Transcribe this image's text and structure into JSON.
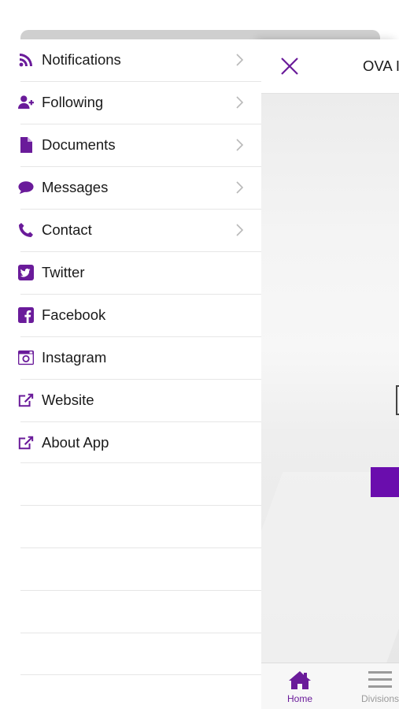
{
  "menu": {
    "items": [
      {
        "label": "Notifications",
        "icon": "rss-icon",
        "has_chevron": true
      },
      {
        "label": "Following",
        "icon": "user-plus-icon",
        "has_chevron": true
      },
      {
        "label": "Documents",
        "icon": "document-icon",
        "has_chevron": true
      },
      {
        "label": "Messages",
        "icon": "chat-bubble-icon",
        "has_chevron": true
      },
      {
        "label": "Contact",
        "icon": "phone-icon",
        "has_chevron": true
      },
      {
        "label": "Twitter",
        "icon": "twitter-icon",
        "has_chevron": false
      },
      {
        "label": "Facebook",
        "icon": "facebook-icon",
        "has_chevron": false
      },
      {
        "label": "Instagram",
        "icon": "instagram-icon",
        "has_chevron": false
      },
      {
        "label": "Website",
        "icon": "external-link-icon",
        "has_chevron": false
      },
      {
        "label": "About App",
        "icon": "external-link-icon",
        "has_chevron": false
      }
    ]
  },
  "panel": {
    "title": "OVA I"
  },
  "tabbar": {
    "home_label": "Home",
    "divisions_label": "Divisions"
  },
  "colors": {
    "accent": "#6a1b9a",
    "inactive": "#9a9a9a"
  }
}
